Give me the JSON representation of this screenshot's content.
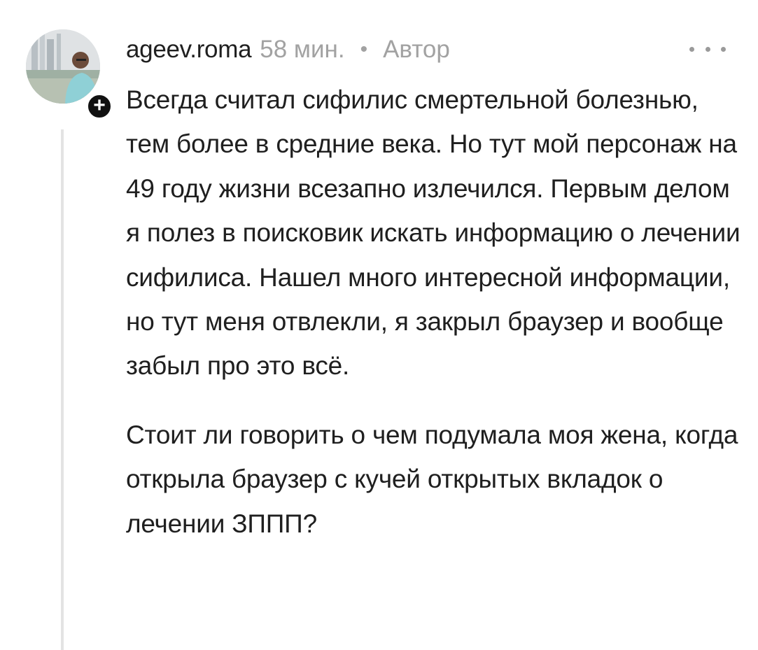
{
  "comment": {
    "username": "ageev.roma",
    "time": "58 мин.",
    "separator": "•",
    "author_tag": "Автор",
    "follow_symbol": "+",
    "paragraphs": [
      "Всегда считал сифилис смертельной болезнью, тем более в средние века. Но тут мой персонаж на 49 году жизни всезапно излечился. Первым делом я полез в поисковик искать информацию о лечении сифилиса. Нашел много интересной информации, но тут меня отвлекли, я закрыл браузер и вообще забыл про это всё.",
      "Стоит ли говорить о чем подумала моя жена, когда открыла браузер с кучей открытых вкладок о лечении ЗППП?"
    ]
  },
  "icons": {
    "avatar": "user-photo",
    "follow": "plus-icon",
    "more": "more-horizontal-icon"
  },
  "colors": {
    "text": "#1f1f1f",
    "muted": "#a2a2a2",
    "thread_line": "#e3e3e3",
    "badge": "#111111"
  }
}
